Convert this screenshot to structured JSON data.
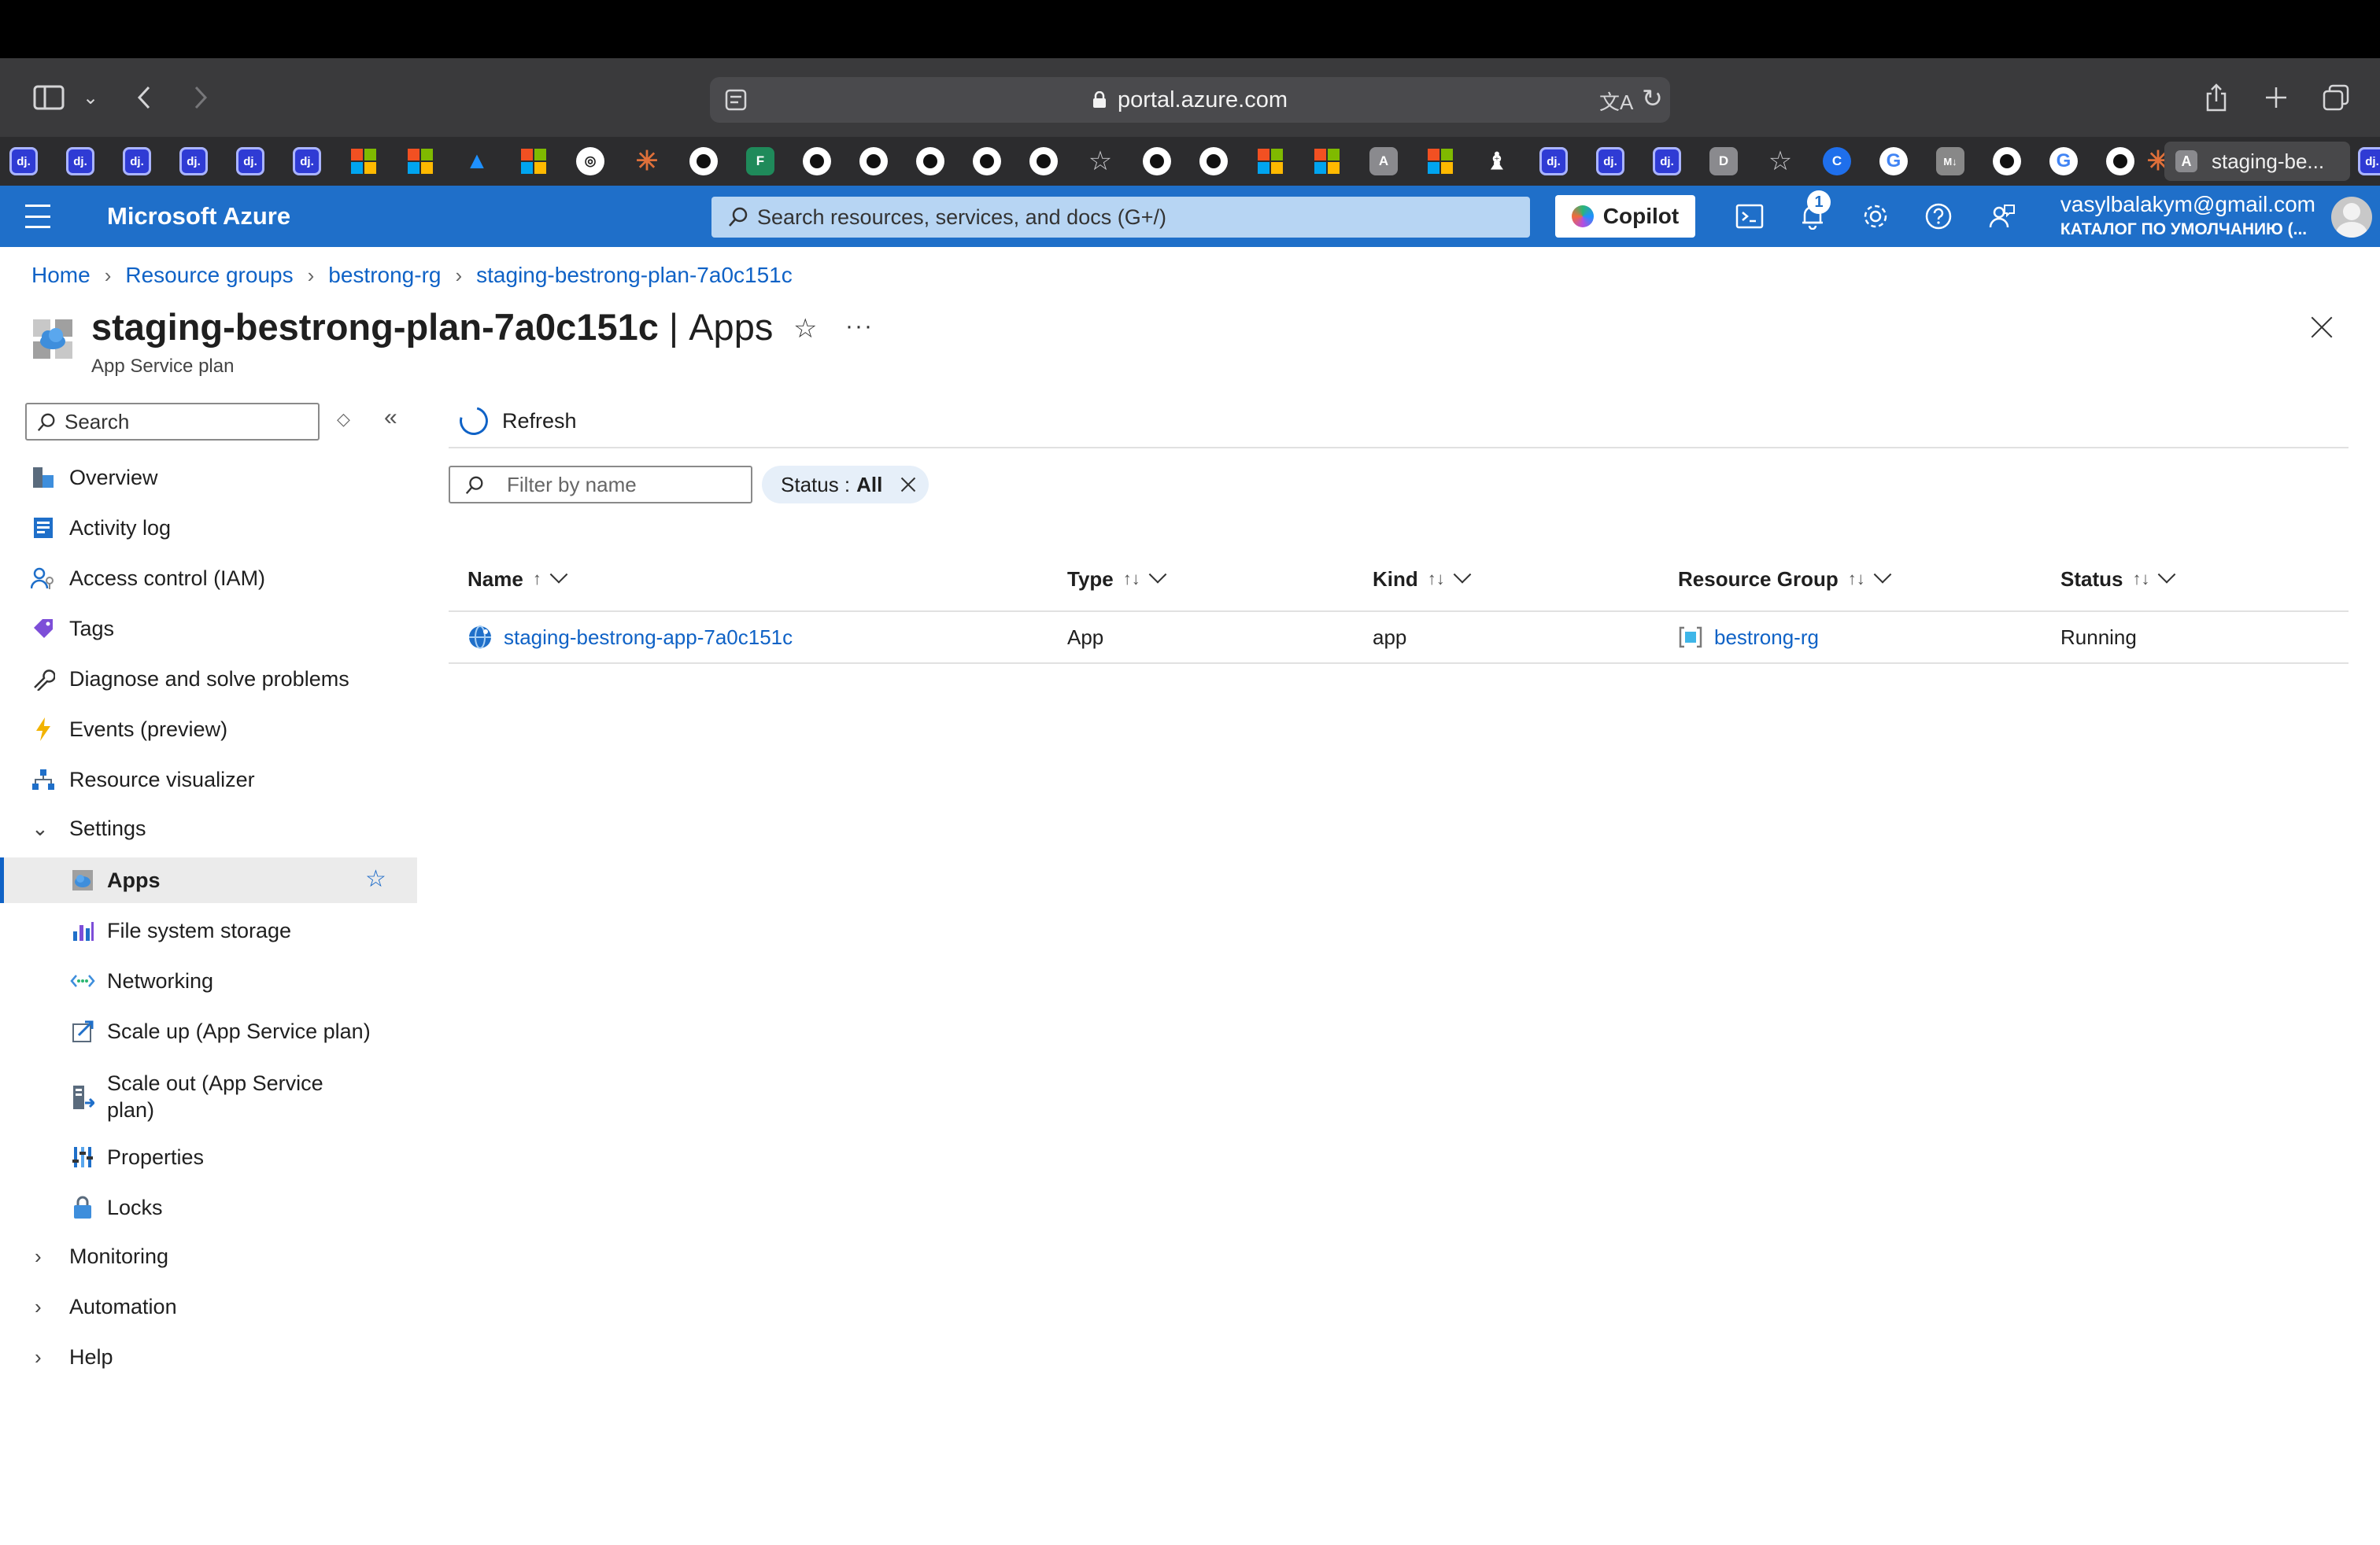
{
  "browser": {
    "url": "portal.azure.com",
    "active_tab_title": "staging-be...",
    "active_tab_favicon": "A"
  },
  "bookmarks": [
    {
      "label": "dj."
    },
    {
      "label": "dj."
    },
    {
      "label": "dj."
    },
    {
      "label": "dj."
    },
    {
      "label": "dj."
    },
    {
      "label": "dj."
    },
    {
      "label": "A"
    },
    {
      "label": "A"
    },
    {
      "label": "D"
    },
    {
      "label": "M↓"
    }
  ],
  "header": {
    "brand": "Microsoft Azure",
    "search_placeholder": "Search resources, services, and docs (G+/)",
    "copilot_label": "Copilot",
    "notification_count": "1",
    "account_email": "vasylbalakym@gmail.com",
    "account_directory": "КАТАЛОГ ПО УМОЛЧАНИЮ (..."
  },
  "breadcrumb": [
    "Home",
    "Resource groups",
    "bestrong-rg",
    "staging-bestrong-plan-7a0c151c"
  ],
  "page": {
    "title_resource": "staging-bestrong-plan-7a0c151c",
    "title_separator": "|",
    "title_section": "Apps",
    "subtitle": "App Service plan",
    "more": "···"
  },
  "nav": {
    "search_placeholder": "Search",
    "items": [
      {
        "label": "Overview",
        "icon": "overview-icon"
      },
      {
        "label": "Activity log",
        "icon": "activity-log-icon"
      },
      {
        "label": "Access control (IAM)",
        "icon": "iam-icon"
      },
      {
        "label": "Tags",
        "icon": "tag-icon"
      },
      {
        "label": "Diagnose and solve problems",
        "icon": "wrench-icon"
      },
      {
        "label": "Events (preview)",
        "icon": "lightning-icon"
      },
      {
        "label": "Resource visualizer",
        "icon": "visualizer-icon"
      }
    ],
    "settings_group": "Settings",
    "settings_items": [
      {
        "label": "Apps",
        "icon": "app-service-icon",
        "active": true
      },
      {
        "label": "File system storage",
        "icon": "storage-chart-icon"
      },
      {
        "label": "Networking",
        "icon": "networking-icon"
      },
      {
        "label": "Scale up (App Service plan)",
        "icon": "scale-up-icon"
      },
      {
        "label": "Scale out (App Service plan)",
        "icon": "scale-out-icon"
      },
      {
        "label": "Properties",
        "icon": "properties-icon"
      },
      {
        "label": "Locks",
        "icon": "lock-icon"
      }
    ],
    "collapsed_groups": [
      "Monitoring",
      "Automation",
      "Help"
    ]
  },
  "toolbar": {
    "refresh_label": "Refresh",
    "filter_placeholder": "Filter by name",
    "status_filter_label": "Status :",
    "status_filter_value": "All"
  },
  "table": {
    "columns": [
      {
        "label": "Name",
        "sort": "↑"
      },
      {
        "label": "Type",
        "sort": "↑↓"
      },
      {
        "label": "Kind",
        "sort": "↑↓"
      },
      {
        "label": "Resource Group",
        "sort": "↑↓"
      },
      {
        "label": "Status",
        "sort": "↑↓"
      }
    ],
    "rows": [
      {
        "name": "staging-bestrong-app-7a0c151c",
        "type": "App",
        "kind": "app",
        "resource_group": "bestrong-rg",
        "status": "Running"
      }
    ]
  },
  "colors": {
    "azure_header": "#1f6fc9",
    "link": "#0f62c6",
    "active_nav_bg": "#ebebeb"
  }
}
